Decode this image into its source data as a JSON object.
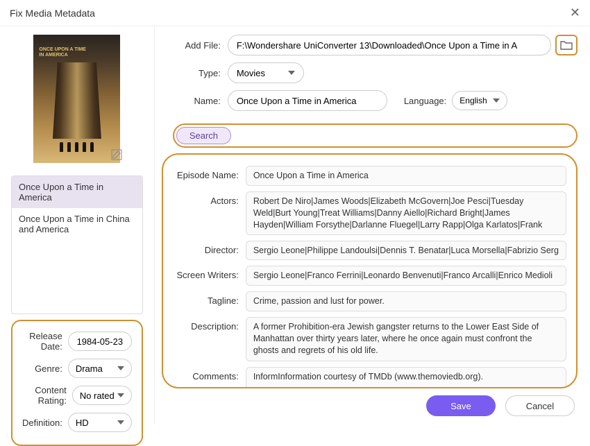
{
  "window": {
    "title": "Fix Media Metadata"
  },
  "top": {
    "add_file_label": "Add File:",
    "add_file_value": "F:\\Wondershare UniConverter 13\\Downloaded\\Once Upon a Time in A",
    "type_label": "Type:",
    "type_value": "Movies",
    "name_label": "Name:",
    "name_value": "Once Upon a Time in America",
    "language_label": "Language:",
    "language_value": "English",
    "search_label": "Search"
  },
  "poster": {
    "title_line1": "ONCE UPON A TIME",
    "title_line2": "IN AMERICA"
  },
  "results": [
    "Once Upon a Time in America",
    "Once Upon a Time in China and America"
  ],
  "selected_result_index": 0,
  "left_fields": {
    "release_date_label": "Release Date:",
    "release_date_value": "1984-05-23",
    "genre_label": "Genre:",
    "genre_value": "Drama",
    "content_rating_label": "Content Rating:",
    "content_rating_value": "No rated",
    "definition_label": "Definition:",
    "definition_value": "HD"
  },
  "details": {
    "episode_name_label": "Episode Name:",
    "episode_name": "Once Upon a Time in America",
    "actors_label": "Actors:",
    "actors": "Robert De Niro|James Woods|Elizabeth McGovern|Joe Pesci|Tuesday Weld|Burt Young|Treat Williams|Danny Aiello|Richard Bright|James Hayden|William Forsythe|Darlanne Fluegel|Larry Rapp|Olga Karlatos|Frank",
    "director_label": "Director:",
    "director": "Sergio Leone|Philippe Landoulsi|Dennis T. Benatar|Luca Morsella|Fabrizio Serg",
    "screenwriters_label": "Screen Writers:",
    "screenwriters": "Sergio Leone|Franco Ferrini|Leonardo Benvenuti|Franco Arcalli|Enrico Medioli",
    "tagline_label": "Tagline:",
    "tagline": "Crime, passion and lust for power.",
    "description_label": "Description:",
    "description": "A former Prohibition-era Jewish gangster returns to the Lower East Side of Manhattan over thirty years later, where he once again must confront the ghosts and regrets of his old life.",
    "comments_label": "Comments:",
    "comments": "InformInformation courtesy of TMDb (www.themoviedb.org)."
  },
  "footer": {
    "save": "Save",
    "cancel": "Cancel"
  }
}
